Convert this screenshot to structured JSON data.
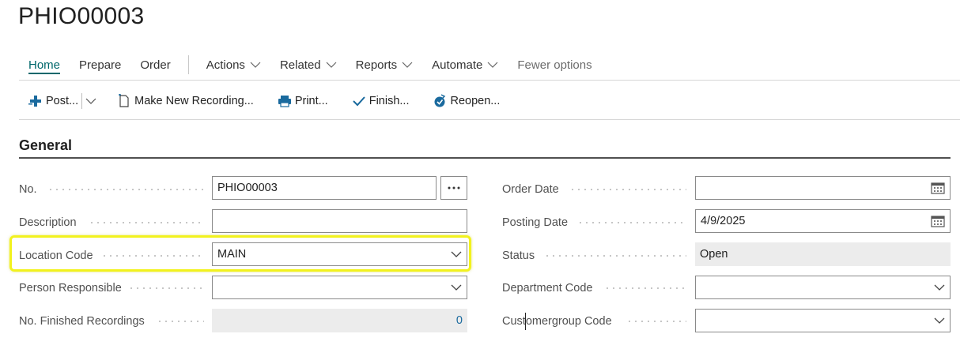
{
  "page": {
    "title": "PHIO00003"
  },
  "menu": {
    "home": "Home",
    "prepare": "Prepare",
    "order": "Order",
    "actions": "Actions",
    "related": "Related",
    "reports": "Reports",
    "automate": "Automate",
    "fewer_options": "Fewer options"
  },
  "actions": {
    "post": "Post...",
    "make_new_recording": "Make New Recording...",
    "print": "Print...",
    "finish": "Finish...",
    "reopen": "Reopen..."
  },
  "section": {
    "title": "General"
  },
  "fields": {
    "no": {
      "label": "No.",
      "value": "PHIO00003"
    },
    "description": {
      "label": "Description",
      "value": ""
    },
    "location_code": {
      "label": "Location Code",
      "value": "MAIN"
    },
    "person_responsible": {
      "label": "Person Responsible",
      "value": ""
    },
    "no_finished_recordings": {
      "label": "No. Finished Recordings",
      "value": "0"
    },
    "order_date": {
      "label": "Order Date",
      "value": ""
    },
    "posting_date": {
      "label": "Posting Date",
      "value": "4/9/2025"
    },
    "status": {
      "label": "Status",
      "value": "Open"
    },
    "department_code": {
      "label": "Department Code",
      "value": ""
    },
    "customergroup_code": {
      "label": "Customergroup Code",
      "value": ""
    }
  },
  "colors": {
    "accent": "#00676b",
    "highlight": "#f2f21e",
    "readonly_bg": "#ececec"
  }
}
